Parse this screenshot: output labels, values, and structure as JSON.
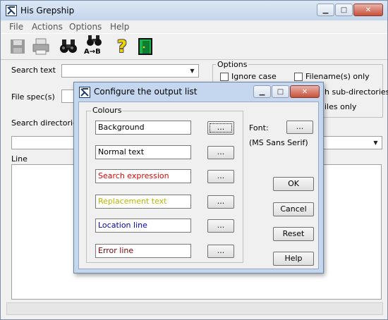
{
  "app": {
    "title": "His Grepship",
    "menu": [
      "File",
      "Actions",
      "Options",
      "Help"
    ],
    "toolbar_icons": [
      "save-icon",
      "print-icon",
      "find-icon",
      "replace-icon",
      "help-icon",
      "exit-icon"
    ],
    "toolbar_replace_caption": "A→B"
  },
  "form": {
    "search_text_label": "Search text",
    "file_spec_label": "File spec(s)",
    "search_dirs_label": "Search directories/fi",
    "line_label": "Line",
    "options_title": "Options",
    "ignore_case": "Ignore case",
    "filenames_only": "Filename(s) only",
    "sub_dirs_partial": "h sub-directories",
    "files_only_partial": "iles only"
  },
  "dialog": {
    "title": "Configure the output list",
    "colours_title": "Colours",
    "font_label": "Font:",
    "font_name": "(MS Sans Serif)",
    "dots": "...",
    "rows": [
      {
        "label": "Background",
        "color": "#000000"
      },
      {
        "label": "Normal text",
        "color": "#000000"
      },
      {
        "label": "Search expression",
        "color": "#e00000"
      },
      {
        "label": "Replacement text",
        "color": "#b8b800"
      },
      {
        "label": "Location line",
        "color": "#0000c0"
      },
      {
        "label": "Error line",
        "color": "#800000"
      }
    ],
    "buttons": {
      "ok": "OK",
      "cancel": "Cancel",
      "reset": "Reset",
      "help": "Help"
    }
  }
}
